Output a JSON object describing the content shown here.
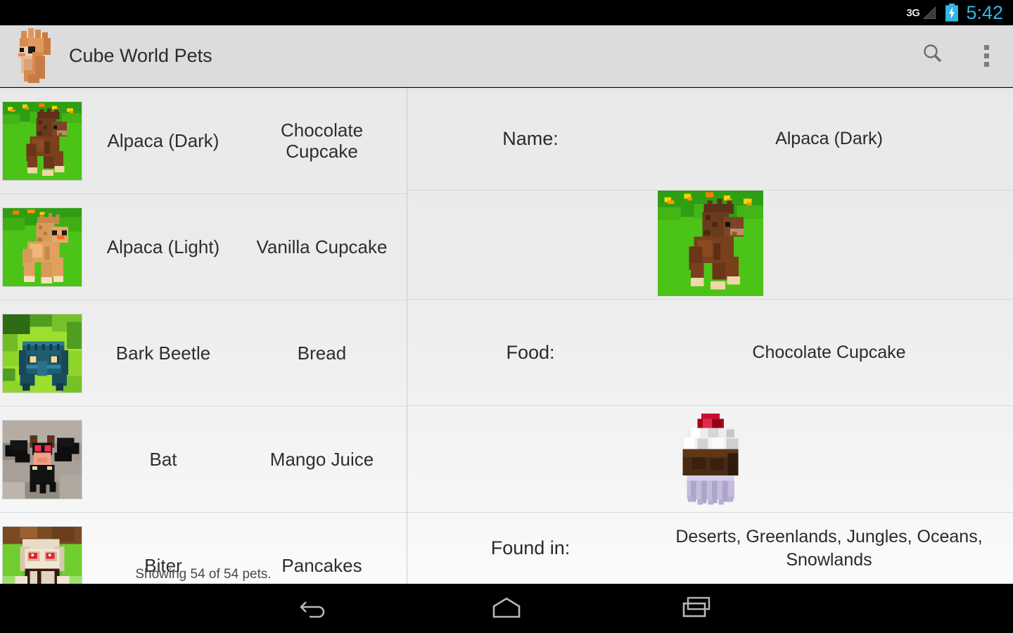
{
  "statusbar": {
    "network": "3G",
    "time": "5:42",
    "accent_color": "#33b5e5",
    "battery_icon": "battery-charging-icon",
    "signal_icon": "signal-bars-icon"
  },
  "actionbar": {
    "app_icon": "alpaca-head-icon",
    "title": "Cube World Pets",
    "search_icon": "search-icon",
    "overflow_icon": "overflow-menu-icon",
    "background_color": "#dcdcdc"
  },
  "list": {
    "footer": "Showing 54 of 54 pets.",
    "rows": [
      {
        "thumb": "alpaca-dark-thumb",
        "name": "Alpaca (Dark)",
        "food": "Chocolate Cupcake",
        "selected": true
      },
      {
        "thumb": "alpaca-light-thumb",
        "name": "Alpaca (Light)",
        "food": "Vanilla Cupcake",
        "selected": false
      },
      {
        "thumb": "bark-beetle-thumb",
        "name": "Bark Beetle",
        "food": "Bread",
        "selected": false
      },
      {
        "thumb": "bat-thumb",
        "name": "Bat",
        "food": "Mango Juice",
        "selected": false
      },
      {
        "thumb": "biter-thumb",
        "name": "Biter",
        "food": "Pancakes",
        "selected": false
      }
    ]
  },
  "detail": {
    "name_label": "Name:",
    "name_value": "Alpaca (Dark)",
    "pet_image": "alpaca-dark-image",
    "food_label": "Food:",
    "food_value": "Chocolate Cupcake",
    "food_image": "chocolate-cupcake-image",
    "found_label": "Found in:",
    "found_value": "Deserts, Greenlands, Jungles, Oceans, Snowlands"
  },
  "navbar": {
    "back": "back-icon",
    "home": "home-icon",
    "recents": "recents-icon"
  }
}
